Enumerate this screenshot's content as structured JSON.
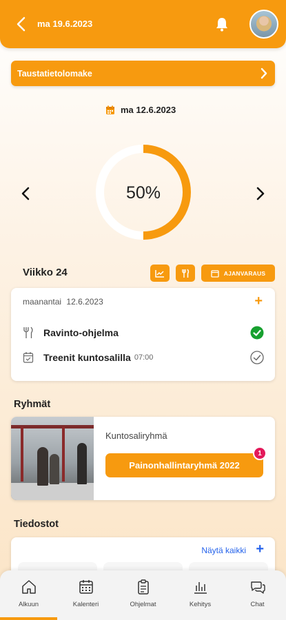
{
  "header": {
    "date": "ma 19.6.2023"
  },
  "banner": {
    "label": "Taustatietolomake"
  },
  "selected_date": "ma 12.6.2023",
  "progress": {
    "value": 50,
    "text": "50%"
  },
  "week": {
    "label": "Viikko 24",
    "booking_label": "AJANVARAUS"
  },
  "day": {
    "weekday": "maanantai",
    "date": "12.6.2023",
    "tasks": [
      {
        "label": "Ravinto-ohjelma",
        "time": "",
        "done": true
      },
      {
        "label": "Treenit kuntosalilla",
        "time": "07:00",
        "done": false
      }
    ]
  },
  "groups": {
    "title": "Ryhmät",
    "card": {
      "name": "Kuntosaliryhmä",
      "button": "Painonhallintaryhmä 2022",
      "badge": "1"
    }
  },
  "files": {
    "title": "Tiedostot",
    "show_all": "Näytä kaikki"
  },
  "nav": {
    "items": [
      {
        "label": "Alkuun",
        "icon": "home-icon",
        "active": true
      },
      {
        "label": "Kalenteri",
        "icon": "calendar-icon",
        "active": false
      },
      {
        "label": "Ohjelmat",
        "icon": "clipboard-icon",
        "active": false
      },
      {
        "label": "Kehitys",
        "icon": "bar-chart-icon",
        "active": false
      },
      {
        "label": "Chat",
        "icon": "chat-icon",
        "active": false
      }
    ]
  },
  "colors": {
    "accent": "#f79a0f",
    "badge": "#e3195a",
    "link": "#2563eb",
    "success": "#17a02f"
  }
}
